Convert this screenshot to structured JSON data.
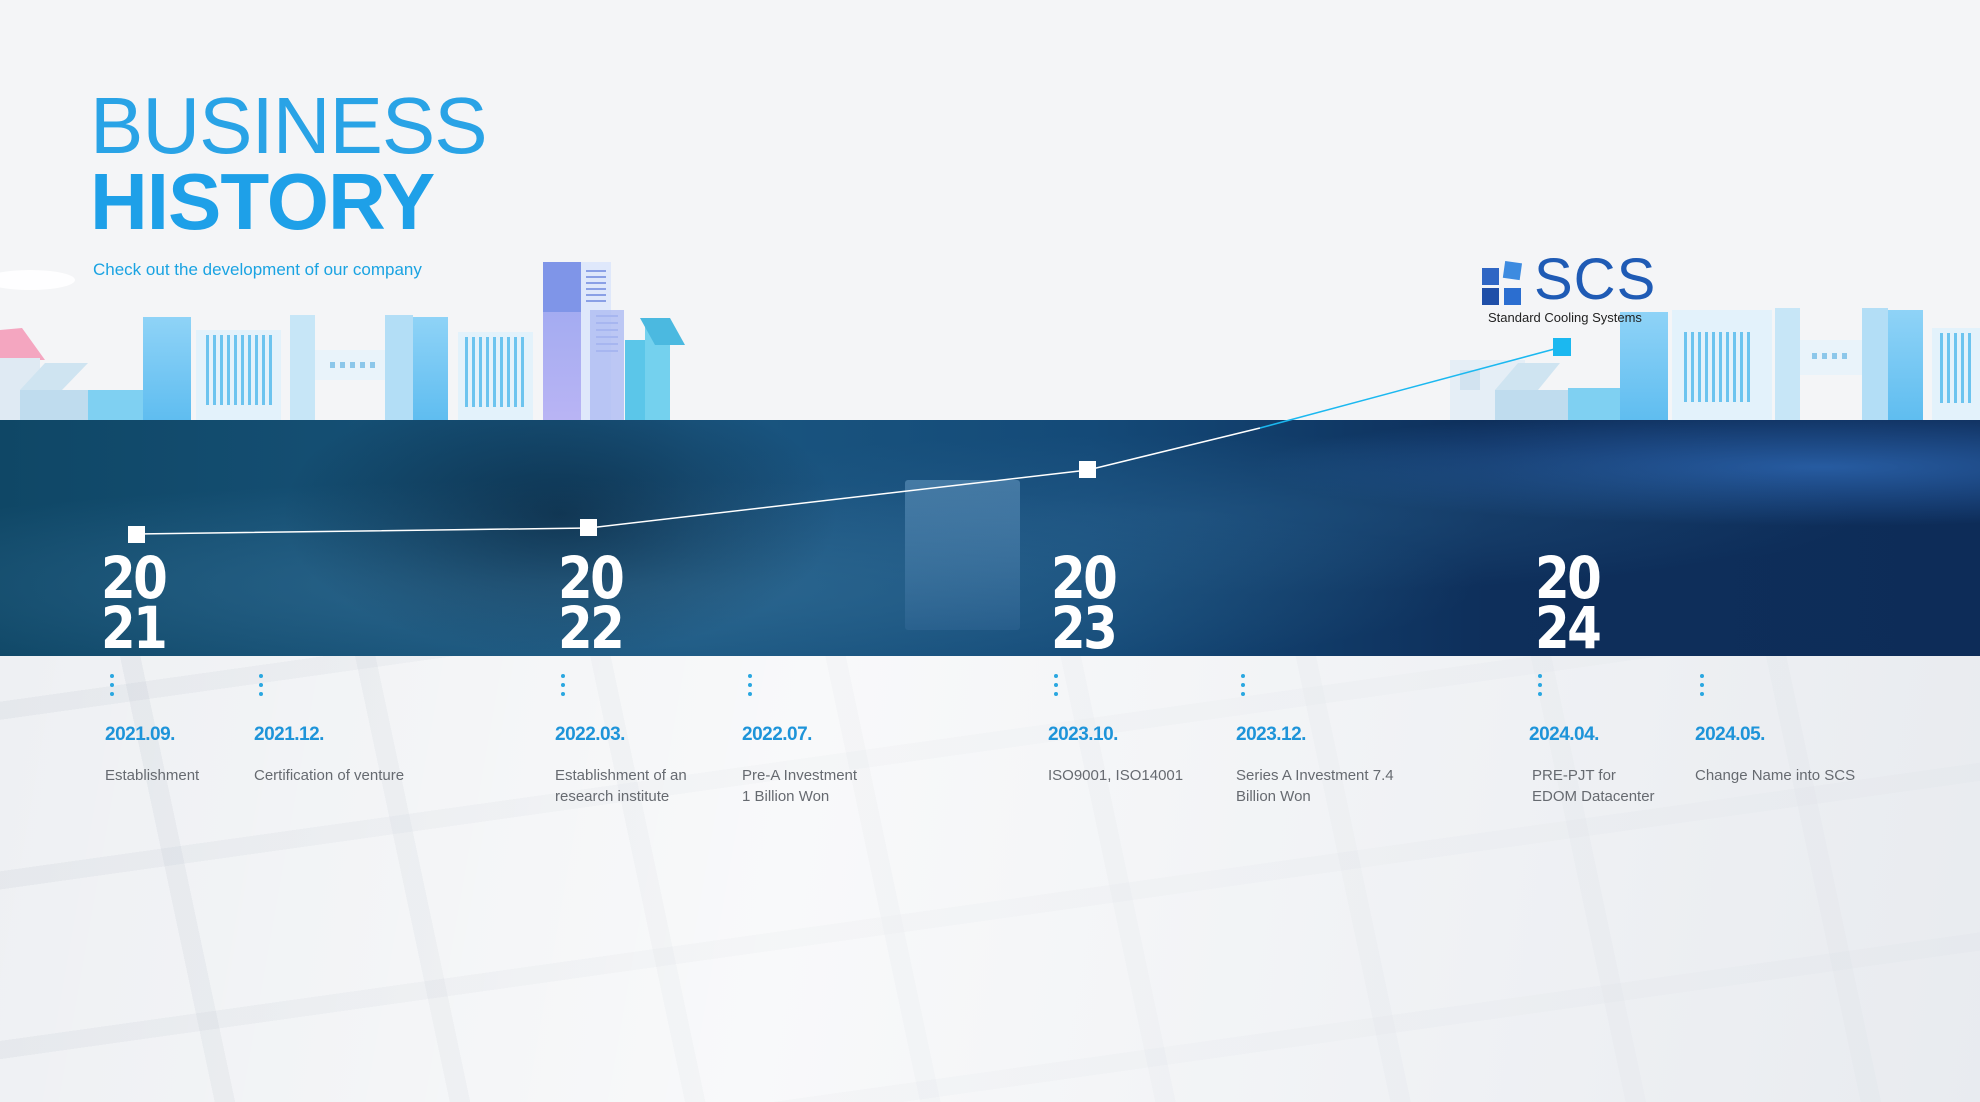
{
  "header": {
    "title_line1": "BUSINESS",
    "title_line2": "HISTORY",
    "subtitle": "Check out the development of our company"
  },
  "logo": {
    "name": "SCS",
    "tagline": "Standard Cooling Systems"
  },
  "years": [
    {
      "top": "20",
      "bottom": "21"
    },
    {
      "top": "20",
      "bottom": "22"
    },
    {
      "top": "20",
      "bottom": "23"
    },
    {
      "top": "20",
      "bottom": "24"
    }
  ],
  "events": [
    {
      "date": "2021.09.",
      "desc1": "Establishment",
      "desc2": ""
    },
    {
      "date": "2021.12.",
      "desc1": "Certification of venture",
      "desc2": ""
    },
    {
      "date": "2022.03.",
      "desc1": "Establishment of an",
      "desc2": "research institute"
    },
    {
      "date": "2022.07.",
      "desc1": "Pre-A Investment",
      "desc2": "1 Billion Won"
    },
    {
      "date": "2023.10.",
      "desc1": "ISO9001, ISO14001",
      "desc2": ""
    },
    {
      "date": "2023.12.",
      "desc1": "Series A Investment 7.4",
      "desc2": "Billion Won"
    },
    {
      "date": "2024.04.",
      "desc1": "PRE-PJT for",
      "desc2": "EDOM Datacenter"
    },
    {
      "date": "2024.05.",
      "desc1": "Change Name into SCS",
      "desc2": ""
    }
  ],
  "colors": {
    "accent": "#1ea0e8",
    "banner_dark": "#0d2c58",
    "logo_blue": "#1f5bb5",
    "highlight_marker": "#1bb8f0"
  }
}
